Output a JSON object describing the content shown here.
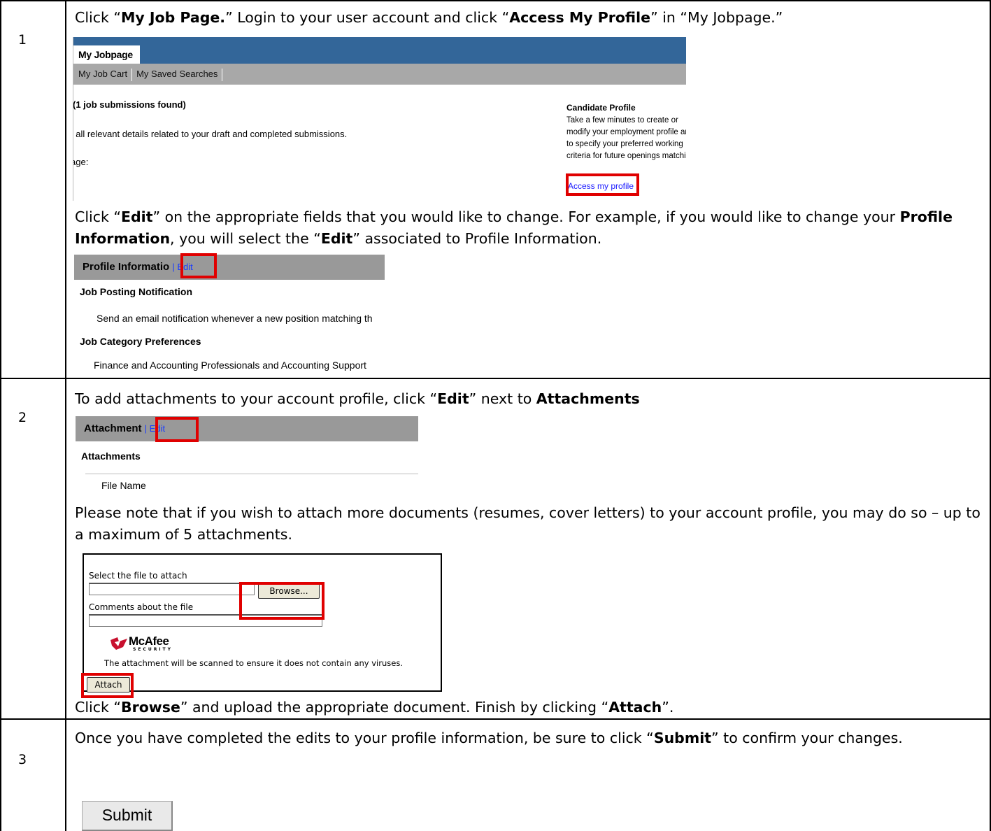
{
  "steps": [
    {
      "number": "1",
      "instructions": [
        {
          "parts": [
            {
              "t": "Click “",
              "b": false
            },
            {
              "t": "My Job Page.",
              "b": true
            },
            {
              "t": "” Login to your user account and click “",
              "b": false
            },
            {
              "t": "Access My Profile",
              "b": true
            },
            {
              "t": "” in “My Jobpage.”",
              "b": false
            }
          ]
        },
        {
          "parts": [
            {
              "t": "Click “",
              "b": false
            },
            {
              "t": "Edit",
              "b": true
            },
            {
              "t": "” on the appropriate fields that you would like to change.  For example, if you would like to change your ",
              "b": false
            },
            {
              "t": "Profile Information",
              "b": true
            },
            {
              "t": ", you will select the “",
              "b": false
            },
            {
              "t": "Edit",
              "b": true
            },
            {
              "t": "” associated to Profile Information.",
              "b": false
            }
          ]
        }
      ]
    },
    {
      "number": "2",
      "instructions": [
        {
          "parts": [
            {
              "t": "To add attachments to your account profile, click “",
              "b": false
            },
            {
              "t": "Edit",
              "b": true
            },
            {
              "t": "” next to ",
              "b": false
            },
            {
              "t": "Attachments",
              "b": true
            }
          ]
        },
        {
          "parts": [
            {
              "t": "Please note that if you wish to attach more documents (resumes, cover letters) to your account profile, you may do so – up to a maximum of 5  attachments.",
              "b": false
            }
          ]
        },
        {
          "parts": [
            {
              "t": "Click “",
              "b": false
            },
            {
              "t": "Browse",
              "b": true
            },
            {
              "t": "” and upload the appropriate document.  Finish by clicking “",
              "b": false
            },
            {
              "t": "Attach",
              "b": true
            },
            {
              "t": "”.",
              "b": false
            }
          ]
        }
      ]
    },
    {
      "number": "3",
      "instructions": [
        {
          "parts": [
            {
              "t": "Once you have completed the edits to your profile information, be sure to click “",
              "b": false
            },
            {
              "t": "Submit",
              "b": true
            },
            {
              "t": "” to confirm your changes.",
              "b": false
            }
          ]
        }
      ]
    }
  ],
  "jobpage": {
    "tab": "My Jobpage",
    "nav": [
      "My Job Cart",
      "My Saved Searches"
    ],
    "found": "(1 job submissions found)",
    "details": "; all relevant details related to your draft and completed submissions.",
    "page": "age:",
    "side_title": "Candidate Profile",
    "side_text": "Take a few minutes to create or modify your employment profile and to specify your preferred working criteria for future openings matching your interests.",
    "link": "Access my profile"
  },
  "profile": {
    "header": "Profile Informatio",
    "edit": "| Edit",
    "notif_title": "Job Posting Notification",
    "notif_text": "Send an email notification whenever a new position matching th",
    "cat_title": "Job Category Preferences",
    "cat_text": "Finance and Accounting Professionals and Accounting Support"
  },
  "attachments": {
    "header": "Attachment",
    "edit": "| Edit",
    "title": "Attachments",
    "file_name": "File Name"
  },
  "attach_form": {
    "select_label": "Select the file to attach",
    "browse": "Browse...",
    "comments_label": "Comments about the file",
    "mcafee": "McAfee",
    "security": "SECURITY",
    "scan_note": "The attachment will be scanned to ensure it does not contain any viruses.",
    "attach": "Attach"
  },
  "submit": "Submit",
  "colors": {
    "highlight": "#e00000",
    "header_blue": "#336699",
    "link": "#1a3cff"
  }
}
